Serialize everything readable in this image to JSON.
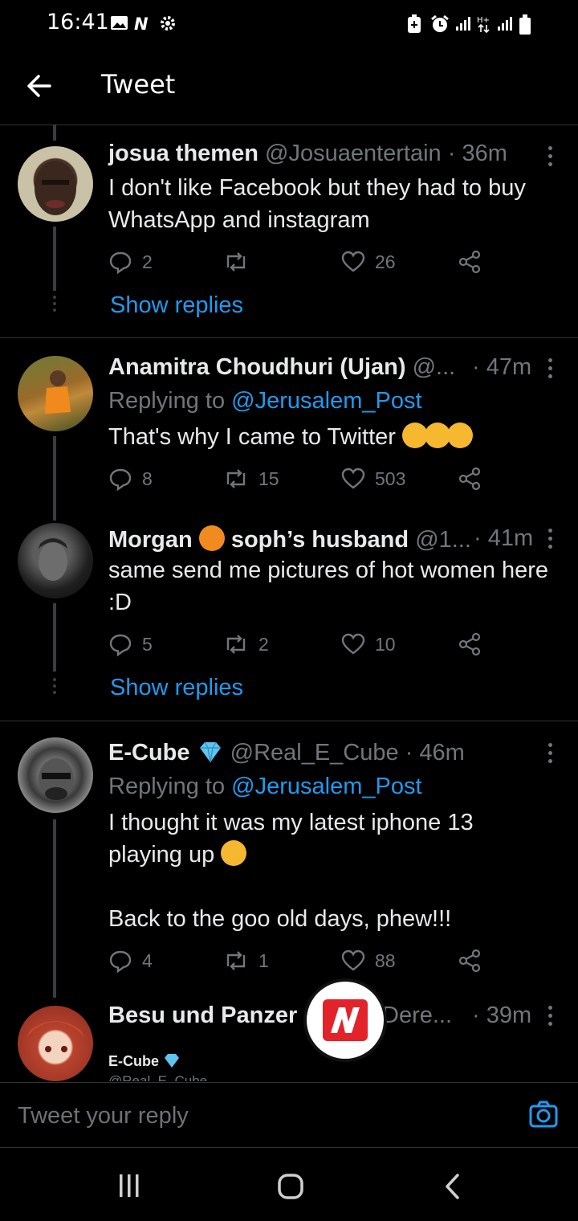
{
  "status_bar": {
    "time": "16:41"
  },
  "header": {
    "title": "Tweet"
  },
  "tweets": [
    {
      "name": "josua themen",
      "handle": "@Josuaentertain",
      "time": "· 36m",
      "text": "I don't like Facebook but they had to buy WhatsApp and instagram",
      "replies": "2",
      "retweets": "",
      "likes": "26",
      "show_replies": "Show replies"
    },
    {
      "name": "Anamitra Choudhuri (Ujan)",
      "handle": "@...",
      "time": "· 47m",
      "replying_prefix": "Replying to ",
      "replying_to": "@Jerusalem_Post",
      "text": "That's why I came to Twitter",
      "replies": "8",
      "retweets": "15",
      "likes": "503"
    },
    {
      "name_part1": "Morgan",
      "name_part2": "soph’s husband",
      "handle": "@1...",
      "time": "· 41m",
      "text": "same send me pictures of hot women here :D",
      "replies": "5",
      "retweets": "2",
      "likes": "10",
      "show_replies": "Show replies"
    },
    {
      "name": "E-Cube",
      "handle": "@Real_E_Cube",
      "time": "· 46m",
      "replying_prefix": "Replying to ",
      "replying_to": "@Jerusalem_Post",
      "text_line1": "I thought it was my latest iphone 13",
      "text_line2": "playing up",
      "text_line3": "Back to the goo old days, phew!!!",
      "replies": "4",
      "retweets": "1",
      "likes": "88"
    },
    {
      "name": "Besu und Panzer",
      "handle": "(",
      "handle_tail": "Dere...",
      "time": "· 39m",
      "quoted_name": "E-Cube",
      "quoted_handle": "@Real_E_Cube"
    }
  ],
  "reply_bar": {
    "placeholder": "Tweet your reply"
  },
  "colors": {
    "accent": "#1d9bf0",
    "background": "#000000",
    "muted": "#71767b"
  }
}
